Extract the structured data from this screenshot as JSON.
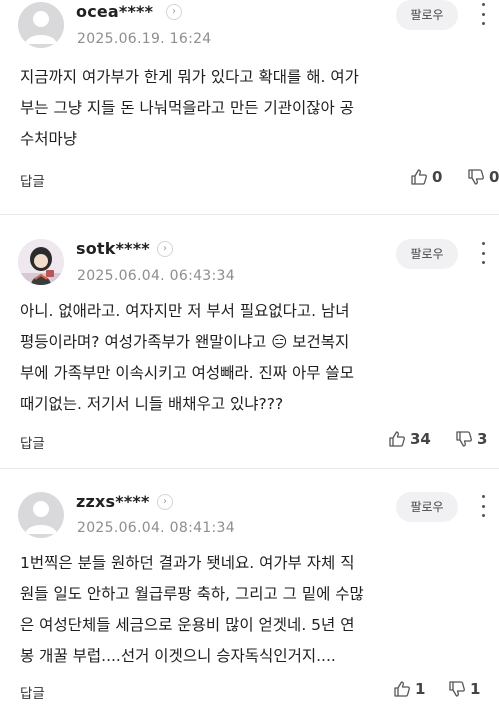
{
  "comments": [
    {
      "username": "ocea****",
      "date": "2025.06.19. 16:24",
      "follow_label": "팔로우",
      "text": "지금까지 여가부가 한게 뭐가 있다고 확대를 해. 여가\n부는 그냥 지들 돈 나눠먹을라고 만든 기관이잖아 공\n수처마냥",
      "reply_label": "답글",
      "likes": "0",
      "dislikes": "0",
      "avatar": "default-avatar"
    },
    {
      "username": "sotk****",
      "date": "2025.06.04. 06:43:34",
      "follow_label": "팔로우",
      "text": "아니. 없애라고. 여자지만 저 부서 필요없다고. 남녀\n평등이라며? 여성가족부가 왠말이냐고 😑 보건복지\n부에 가족부만 이속시키고 여성빼라. 진짜 아무 쓸모\n때기없는. 저기서 니들 배채우고 있냐???",
      "reply_label": "답글",
      "likes": "34",
      "dislikes": "3",
      "avatar": "profile-photo"
    },
    {
      "username": "zzxs****",
      "date": "2025.06.04. 08:41:34",
      "follow_label": "팔로우",
      "text": "1번찍은 분들 원하던 결과가 됏네요. 여가부 자체 직\n원들 일도 안하고 월급루팡 축하, 그리고 그 밑에 수많\n은 여성단체들 세금으로 운용비 많이 얻겟네. 5년 연\n봉 개꿀 부럽....선거 이겟으니 승자독식인거지....",
      "reply_label": "답글",
      "likes": "1",
      "dislikes": "1",
      "avatar": "default-avatar"
    }
  ]
}
